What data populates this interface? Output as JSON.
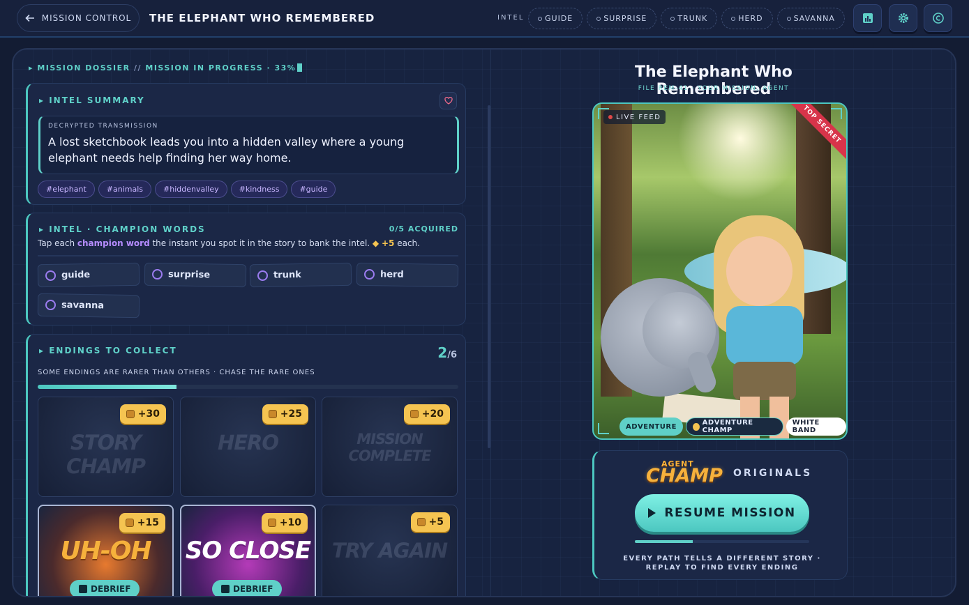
{
  "topbar": {
    "back_label": "MISSION CONTROL",
    "title": "THE ELEPHANT WHO REMEMBERED",
    "intel_label": "INTEL",
    "intel_chips": [
      "GUIDE",
      "SURPRISE",
      "TRUNK",
      "HERD",
      "SAVANNA"
    ],
    "icons": [
      "leaderboard-icon",
      "gear-icon",
      "copyright-icon"
    ]
  },
  "dossier": {
    "label": "MISSION DOSSIER",
    "separator": "//",
    "status": "MISSION IN PROGRESS · 33%"
  },
  "intel_summary": {
    "title": "INTEL SUMMARY",
    "transmission_label": "DECRYPTED TRANSMISSION",
    "transmission_text": "A lost sketchbook leads you into a hidden valley where a young elephant needs help finding her way home.",
    "tags": [
      "#elephant",
      "#animals",
      "#hiddenvalley",
      "#kindness",
      "#guide"
    ]
  },
  "champion_words": {
    "title": "INTEL · CHAMPION WORDS",
    "acquired": "0/5 ACQUIRED",
    "instr_pre": "Tap each ",
    "instr_highlight": "champion word",
    "instr_post": " the instant you spot it in the story to bank the intel. ",
    "instr_bonus": "+5",
    "instr_end": " each.",
    "words": [
      "guide",
      "surprise",
      "trunk",
      "herd",
      "savanna"
    ]
  },
  "endings": {
    "title": "ENDINGS TO COLLECT",
    "count": "2",
    "total": "/6",
    "subtitle": "SOME ENDINGS ARE RARER THAN OTHERS · CHASE THE RARE ONES",
    "progress": 0.33,
    "cards": [
      {
        "name": "STORY CHAMP",
        "reward": "+30",
        "unlocked": false
      },
      {
        "name": "HERO",
        "reward": "+25",
        "unlocked": false
      },
      {
        "name": "MISSION COMPLETE",
        "reward": "+20",
        "unlocked": false
      },
      {
        "name": "UH-OH",
        "reward": "+15",
        "unlocked": true,
        "action": "DEBRIEF"
      },
      {
        "name": "SO CLOSE",
        "reward": "+10",
        "unlocked": true,
        "action": "DEBRIEF"
      },
      {
        "name": "TRY AGAIN",
        "reward": "+5",
        "unlocked": false
      }
    ]
  },
  "book": {
    "title": "The Elephant Who Remembered",
    "file_id": "FILE REM-41 · YOUR MISSION, AGENT",
    "live_label": "LIVE FEED",
    "secret_label": "TOP SECRET",
    "tags": [
      "ADVENTURE",
      "ADVENTURE CHAMP",
      "WHITE BAND"
    ]
  },
  "cta": {
    "logo_top": "AGENT",
    "logo_main": "CHAMP",
    "originals": "ORIGINALS",
    "resume_label": "RESUME MISSION",
    "progress": 0.33,
    "note": "EVERY PATH TELLS A DIFFERENT STORY · REPLAY TO FIND EVERY ENDING"
  },
  "colors": {
    "accent": "#5fd0c8",
    "background": "#131c33",
    "panel": "#1b2746",
    "gold": "#f5c451",
    "purple": "#b58cff",
    "danger": "#d8344a"
  }
}
